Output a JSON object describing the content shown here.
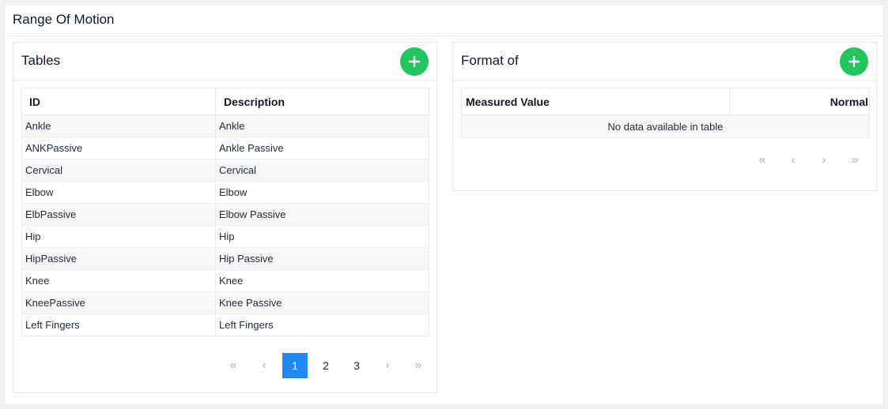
{
  "page": {
    "title": "Range Of Motion"
  },
  "tables_card": {
    "title": "Tables",
    "columns": [
      "ID",
      "Description"
    ],
    "rows": [
      [
        "Ankle",
        "Ankle"
      ],
      [
        "ANKPassive",
        "Ankle Passive"
      ],
      [
        "Cervical",
        "Cervical"
      ],
      [
        "Elbow",
        "Elbow"
      ],
      [
        "ElbPassive",
        "Elbow Passive"
      ],
      [
        "Hip",
        "Hip"
      ],
      [
        "HipPassive",
        "Hip Passive"
      ],
      [
        "Knee",
        "Knee"
      ],
      [
        "KneePassive",
        "Knee Passive"
      ],
      [
        "Left Fingers",
        "Left Fingers"
      ]
    ],
    "pagination": {
      "first": "«",
      "prev": "‹",
      "pages": [
        "1",
        "2",
        "3"
      ],
      "active_page": "1",
      "next": "›",
      "last": "»"
    }
  },
  "format_card": {
    "title": "Format of",
    "columns": [
      "Measured Value",
      "Normal"
    ],
    "empty_message": "No data available in table",
    "pagination": {
      "first": "«",
      "prev": "‹",
      "next": "›",
      "last": "»"
    }
  },
  "colors": {
    "add_button": "#22c55e",
    "active_page": "#1e88f5"
  },
  "icons": {
    "add": "plus-icon"
  }
}
